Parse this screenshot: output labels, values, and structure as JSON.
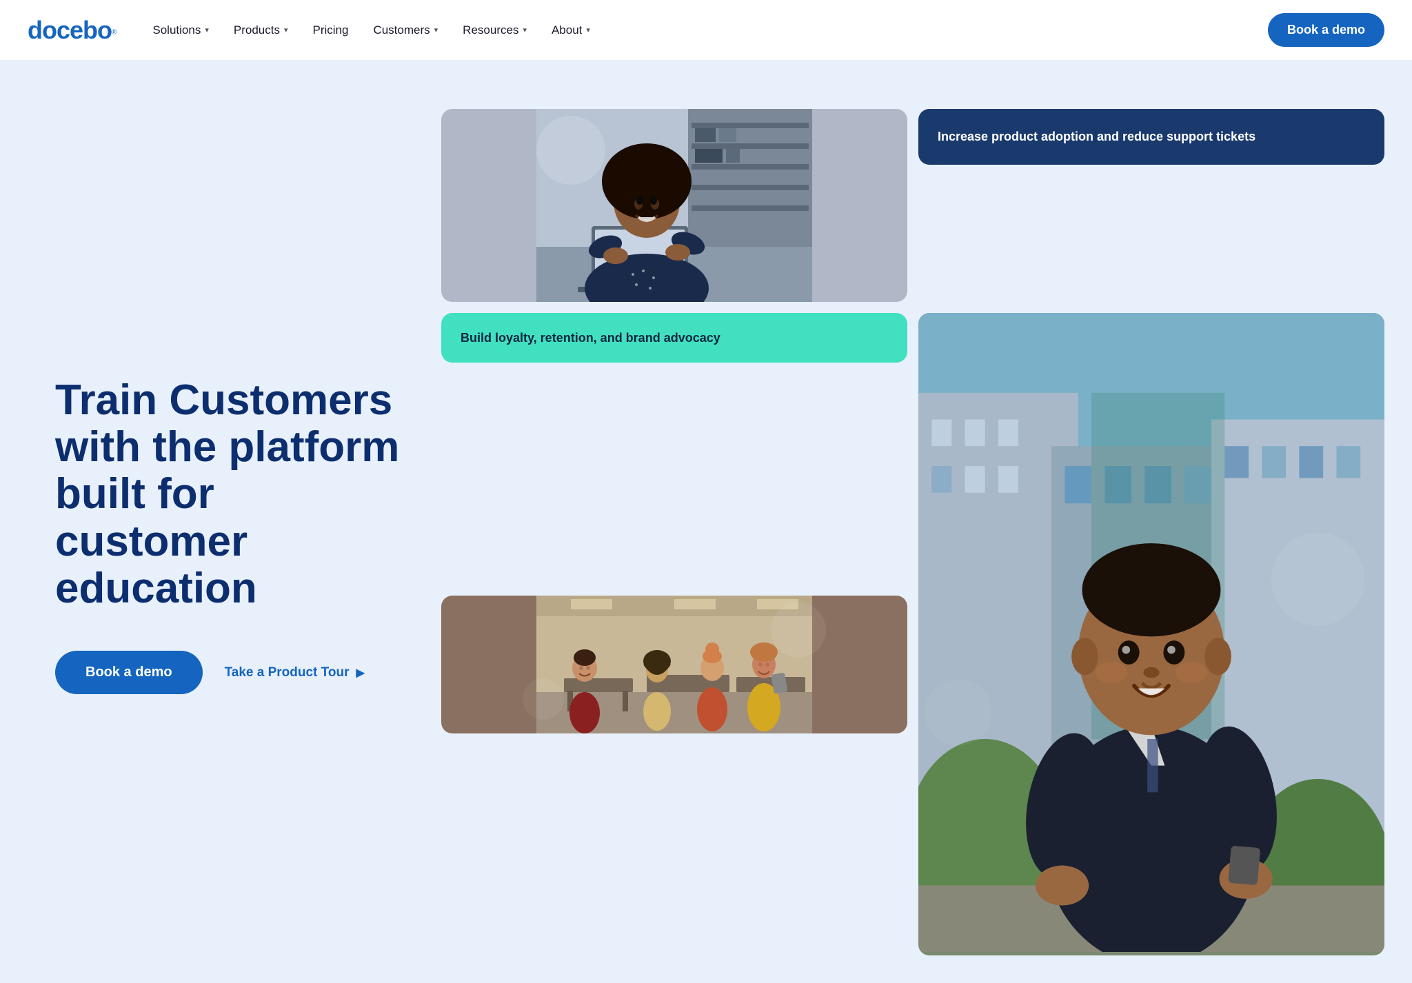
{
  "nav": {
    "logo": "docebo",
    "logo_superscript": "®",
    "links": [
      {
        "id": "solutions",
        "label": "Solutions",
        "has_dropdown": true
      },
      {
        "id": "products",
        "label": "Products",
        "has_dropdown": true
      },
      {
        "id": "pricing",
        "label": "Pricing",
        "has_dropdown": false
      },
      {
        "id": "customers",
        "label": "Customers",
        "has_dropdown": true
      },
      {
        "id": "resources",
        "label": "Resources",
        "has_dropdown": true
      },
      {
        "id": "about",
        "label": "About",
        "has_dropdown": true
      }
    ],
    "book_demo_label": "Book a demo"
  },
  "hero": {
    "heading_line1": "Train Customers",
    "heading_line2": "with the platform",
    "heading_line3": "built for customer",
    "heading_line4": "education",
    "book_demo_label": "Book a demo",
    "product_tour_label": "Take a Product Tour",
    "card_dark_text": "Increase product adoption and reduce support tickets",
    "card_teal_text": "Build loyalty, retention, and brand advocacy"
  },
  "colors": {
    "brand_blue": "#1565c0",
    "dark_navy": "#0d2e6e",
    "hero_bg": "#e8f0fb",
    "card_dark_bg": "#1a3a6e",
    "card_teal_bg": "#40e0c0"
  }
}
